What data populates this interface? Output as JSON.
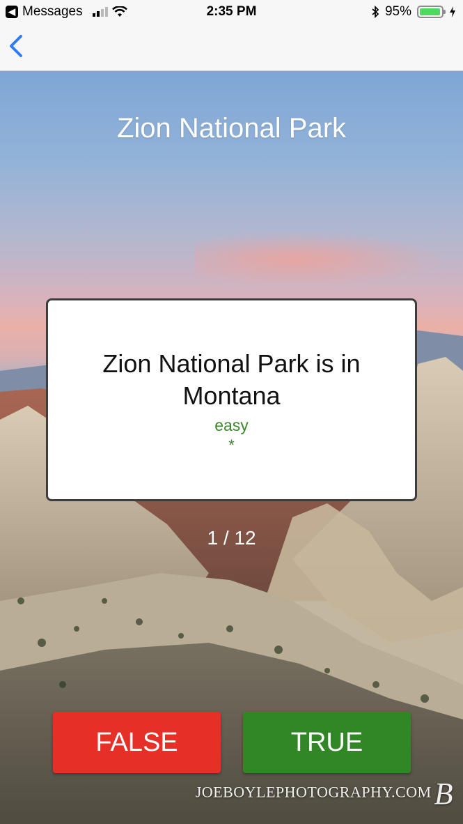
{
  "status_bar": {
    "back_app_label": "Messages",
    "time": "2:35 PM",
    "battery_percent": "95%",
    "battery_level": 0.95
  },
  "nav": {
    "back_icon": "chevron-left-icon",
    "accent_color": "#2f7cf6"
  },
  "screen": {
    "title": "Zion National Park",
    "question": "Zion National Park is in Montana",
    "difficulty": "easy",
    "rating_marker": "*",
    "progress": "1 / 12"
  },
  "actions": {
    "false_label": "FALSE",
    "true_label": "TRUE",
    "false_color": "#e63027",
    "true_color": "#318726"
  },
  "watermark": {
    "text": "JOEBOYLEPHOTOGRAPHY.COM",
    "mark": "B"
  }
}
